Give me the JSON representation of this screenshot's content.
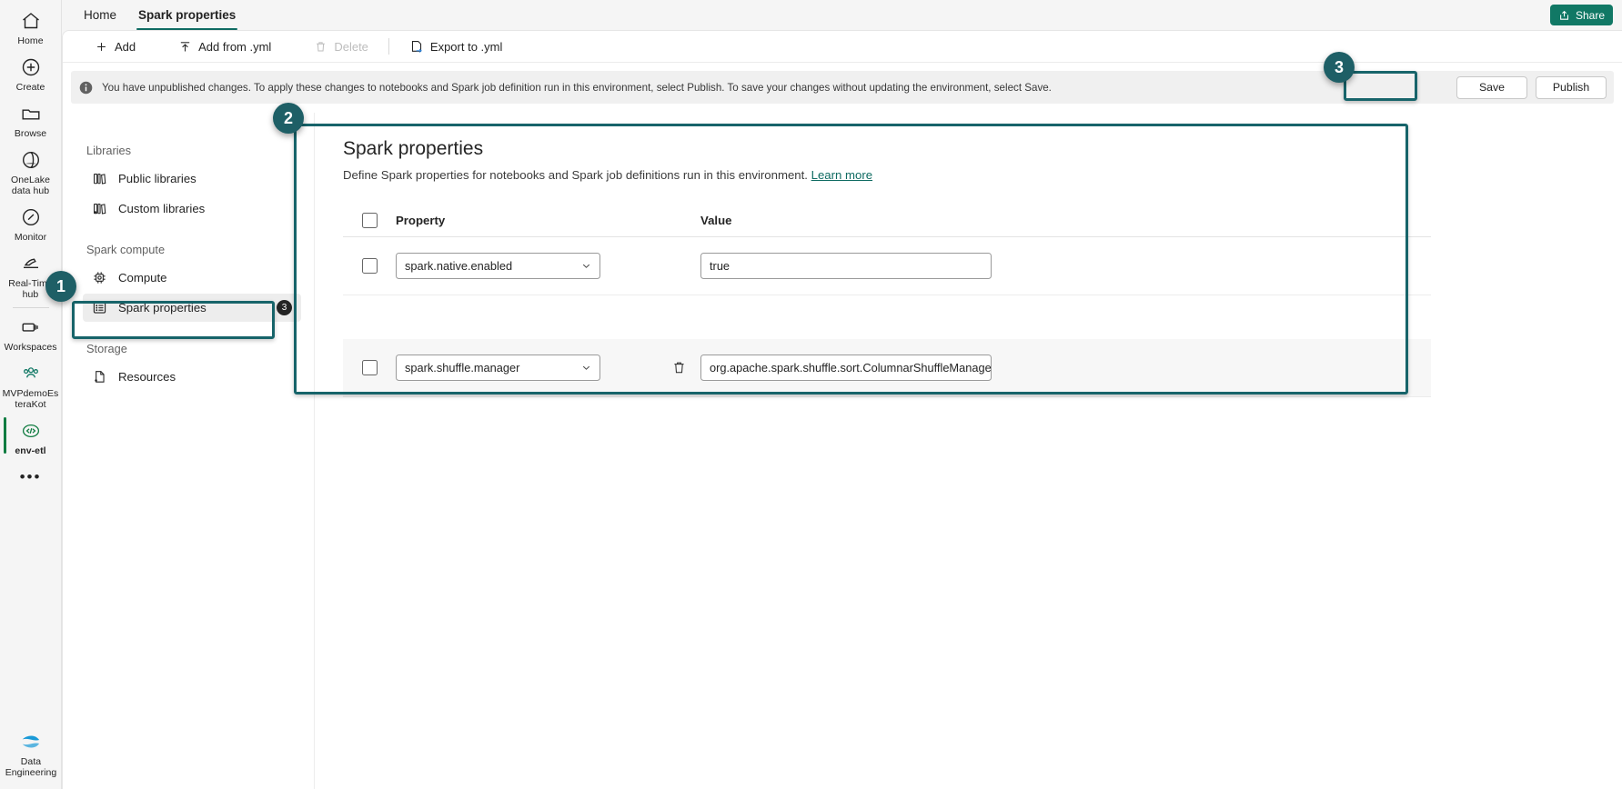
{
  "rail": {
    "items": [
      {
        "label": "Home",
        "icon": "home-icon"
      },
      {
        "label": "Create",
        "icon": "plus-circle-icon"
      },
      {
        "label": "Browse",
        "icon": "folder-icon"
      },
      {
        "label": "OneLake\ndata hub",
        "icon": "onelake-icon"
      },
      {
        "label": "Monitor",
        "icon": "monitor-icon"
      },
      {
        "label": "Real-Time\nhub",
        "icon": "realtime-hub-icon"
      },
      {
        "label": "Workspaces",
        "icon": "workspaces-icon"
      },
      {
        "label": "MVPdemoEs\nteraKot",
        "icon": "people-icon"
      },
      {
        "label": "env-etl",
        "icon": "code-icon"
      }
    ],
    "more_label": "•••",
    "footer": {
      "label": "Data\nEngineering",
      "icon": "data-engineering-icon"
    }
  },
  "topbar": {
    "tabs": [
      {
        "label": "Home",
        "active": false
      },
      {
        "label": "Spark properties",
        "active": true
      }
    ],
    "share_label": "Share",
    "share_color": "#117865"
  },
  "ribbon": {
    "buttons": [
      {
        "label": "Add",
        "icon": "plus-icon",
        "disabled": false
      },
      {
        "label": "Add from .yml",
        "icon": "upload-arrow-icon",
        "disabled": false
      },
      {
        "label": "Delete",
        "icon": "trash-icon",
        "disabled": true
      },
      {
        "label": "Export to .yml",
        "icon": "export-icon",
        "disabled": false
      }
    ]
  },
  "notification": {
    "icon": "info-icon",
    "message": "You have unpublished changes. To apply these changes to notebooks and Spark job definition run in this environment, select Publish. To save your changes without updating the environment, select Save.",
    "save_label": "Save",
    "publish_label": "Publish"
  },
  "nav": {
    "groups": [
      {
        "title": "Libraries",
        "items": [
          {
            "label": "Public libraries",
            "icon": "library-icon",
            "selected": false,
            "badge": null
          },
          {
            "label": "Custom libraries",
            "icon": "custom-library-icon",
            "selected": false,
            "badge": null
          }
        ]
      },
      {
        "title": "Spark compute",
        "items": [
          {
            "label": "Compute",
            "icon": "chip-icon",
            "selected": false,
            "badge": null
          },
          {
            "label": "Spark properties",
            "icon": "properties-list-icon",
            "selected": true,
            "badge": "3"
          }
        ]
      },
      {
        "title": "Storage",
        "items": [
          {
            "label": "Resources",
            "icon": "file-icon",
            "selected": false,
            "badge": null
          }
        ]
      }
    ]
  },
  "main": {
    "title": "Spark properties",
    "description": "Define Spark properties for notebooks and Spark job definitions run in this environment.",
    "learn_more_label": "Learn more",
    "table": {
      "headers": {
        "property": "Property",
        "value": "Value"
      },
      "rows": [
        {
          "checked": false,
          "property": "spark.native.enabled",
          "value": "true",
          "has_delete": false,
          "alt": false
        },
        {
          "checked": false,
          "property": "spark.shuffle.manager",
          "value": "org.apache.spark.shuffle.sort.ColumnarShuffleManager",
          "has_delete": true,
          "alt": true
        }
      ]
    }
  },
  "annotations": {
    "accent_color": "#1e5f66",
    "callouts": [
      {
        "number": "1",
        "target": "nav-item-spark-properties"
      },
      {
        "number": "2",
        "target": "spark-properties-panel"
      },
      {
        "number": "3",
        "target": "publish-button"
      }
    ]
  }
}
